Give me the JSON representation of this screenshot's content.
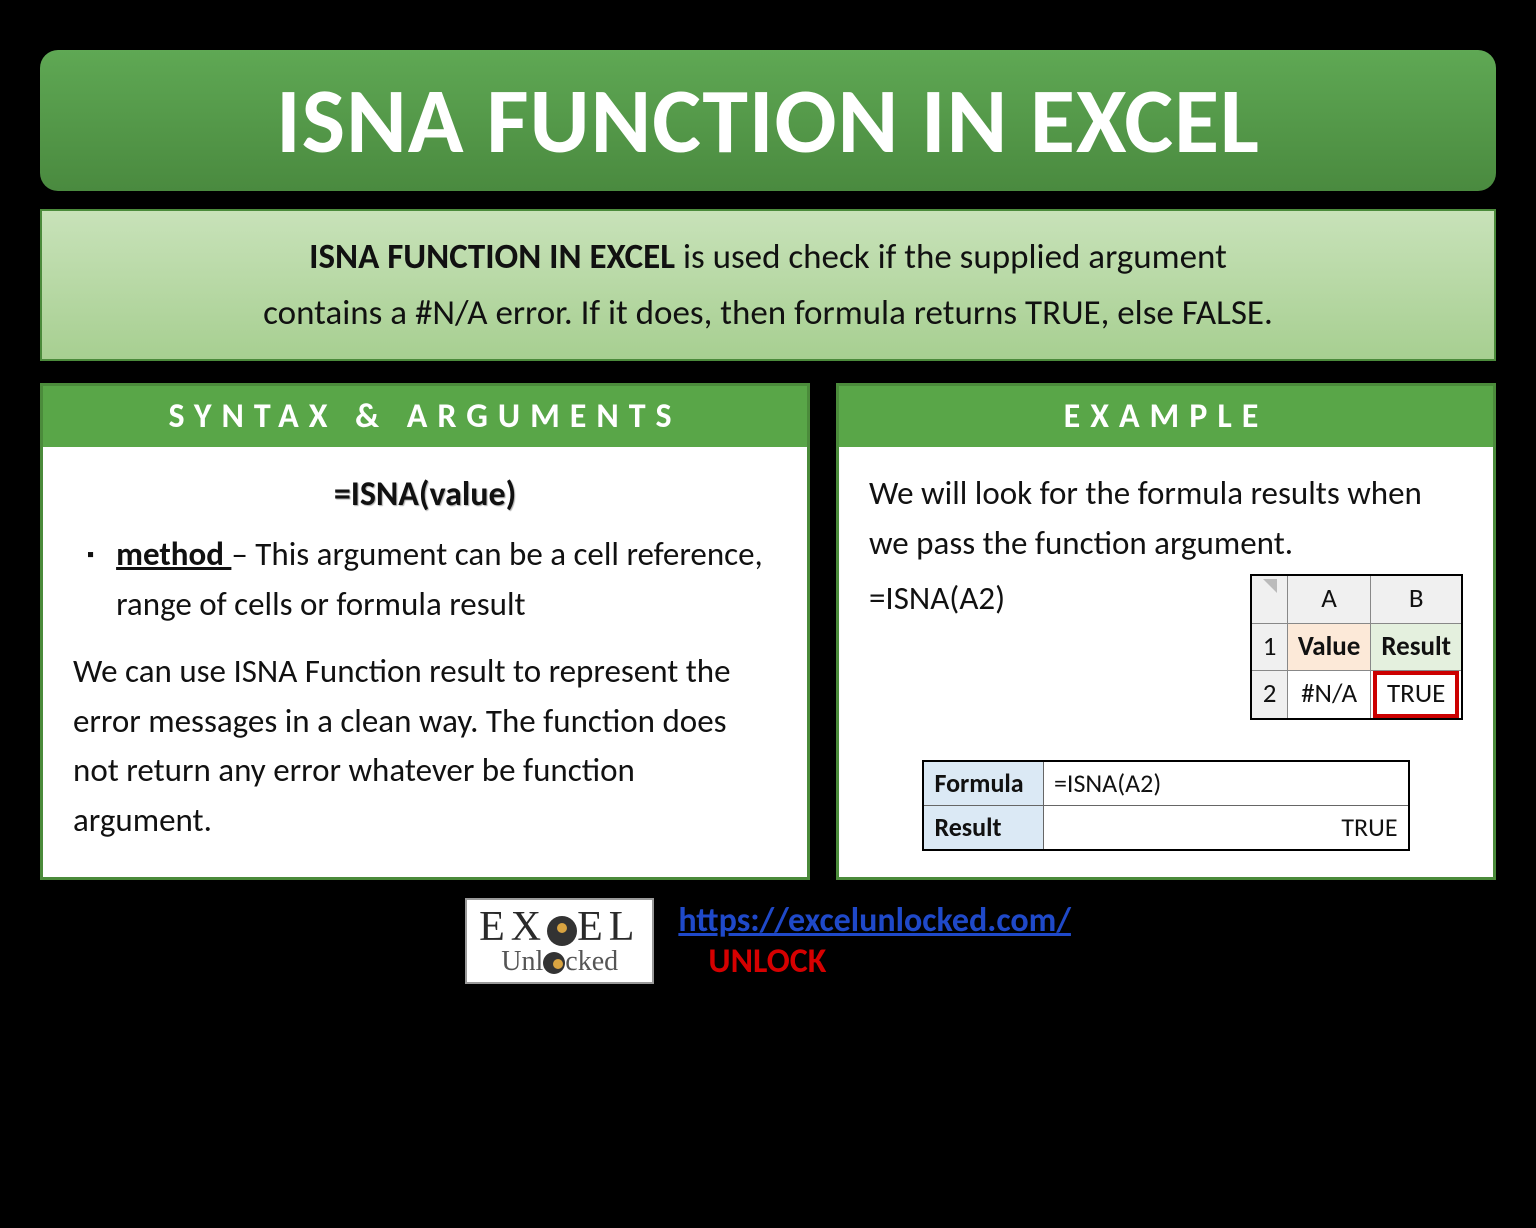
{
  "title": "ISNA FUNCTION IN EXCEL",
  "description": {
    "bold": "ISNA FUNCTION IN EXCEL",
    "rest1": " is used check if the supplied argument",
    "line2": "contains a #N/A error. If it does, then formula returns TRUE, else FALSE."
  },
  "left": {
    "header": "SYNTAX & ARGUMENTS",
    "syntax": "=ISNA(value)",
    "arg_name": "method ",
    "arg_desc": "– This argument can be a cell reference, range of cells or formula result",
    "para": "We can use ISNA Function result to represent the error messages in a clean way. The function does not return any error whatever be function argument."
  },
  "right": {
    "header": "EXAMPLE",
    "intro": "We will look for the formula results when we pass the function argument.",
    "formula_inline": "=ISNA(A2)",
    "grid": {
      "colA": "A",
      "colB": "B",
      "row1": "1",
      "row2": "2",
      "h_value": "Value",
      "h_result": "Result",
      "v_value": "#N/A",
      "v_result": "TRUE"
    },
    "ftable": {
      "l_formula": "Formula",
      "l_result": "Result",
      "v_formula": "=ISNA(A2)",
      "v_result": "TRUE"
    }
  },
  "footer": {
    "logo_top": "EX   EL",
    "logo_bot": "Unl   cked",
    "url": "https://excelunlocked.com/",
    "unlock": "UNLOCK"
  }
}
